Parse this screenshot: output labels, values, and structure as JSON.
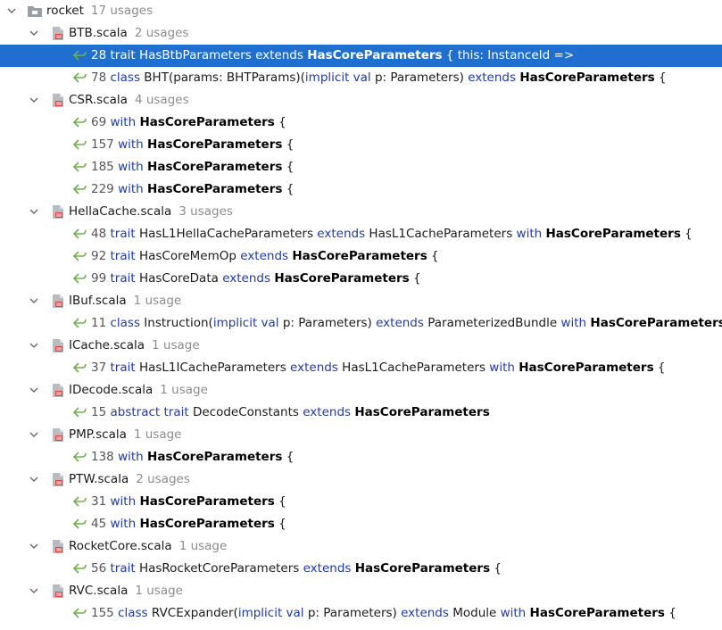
{
  "root": {
    "label": "rocket",
    "usages": "17 usages"
  },
  "files": [
    {
      "name": "BTB.scala",
      "usages": "2 usages",
      "lines": [
        {
          "num": "28",
          "selected": true,
          "parts": [
            {
              "t": "trait",
              "s": "kw"
            },
            {
              "t": " HasBtbParameters "
            },
            {
              "t": "extends",
              "s": "kw"
            },
            {
              "t": " "
            },
            {
              "t": "HasCoreParameters",
              "s": "bold"
            },
            {
              "t": " { this: InstanceId =>"
            }
          ]
        },
        {
          "num": "78",
          "parts": [
            {
              "t": "class",
              "s": "kw"
            },
            {
              "t": " BHT(params: BHTParams)("
            },
            {
              "t": "implicit val",
              "s": "kw"
            },
            {
              "t": " p: Parameters) "
            },
            {
              "t": "extends",
              "s": "kw"
            },
            {
              "t": " "
            },
            {
              "t": "HasCoreParameters",
              "s": "bold"
            },
            {
              "t": " {"
            }
          ]
        }
      ]
    },
    {
      "name": "CSR.scala",
      "usages": "4 usages",
      "lines": [
        {
          "num": "69",
          "parts": [
            {
              "t": "with",
              "s": "kw"
            },
            {
              "t": " "
            },
            {
              "t": "HasCoreParameters",
              "s": "bold"
            },
            {
              "t": " {"
            }
          ]
        },
        {
          "num": "157",
          "parts": [
            {
              "t": "with",
              "s": "kw"
            },
            {
              "t": " "
            },
            {
              "t": "HasCoreParameters",
              "s": "bold"
            },
            {
              "t": " {"
            }
          ]
        },
        {
          "num": "185",
          "parts": [
            {
              "t": "with",
              "s": "kw"
            },
            {
              "t": " "
            },
            {
              "t": "HasCoreParameters",
              "s": "bold"
            },
            {
              "t": " {"
            }
          ]
        },
        {
          "num": "229",
          "parts": [
            {
              "t": "with",
              "s": "kw"
            },
            {
              "t": " "
            },
            {
              "t": "HasCoreParameters",
              "s": "bold"
            },
            {
              "t": " {"
            }
          ]
        }
      ]
    },
    {
      "name": "HellaCache.scala",
      "usages": "3 usages",
      "lines": [
        {
          "num": "48",
          "parts": [
            {
              "t": "trait",
              "s": "kw"
            },
            {
              "t": " HasL1HellaCacheParameters "
            },
            {
              "t": "extends",
              "s": "kw"
            },
            {
              "t": " HasL1CacheParameters "
            },
            {
              "t": "with",
              "s": "kw"
            },
            {
              "t": " "
            },
            {
              "t": "HasCoreParameters",
              "s": "bold"
            },
            {
              "t": " {"
            }
          ]
        },
        {
          "num": "92",
          "parts": [
            {
              "t": "trait",
              "s": "kw"
            },
            {
              "t": " HasCoreMemOp "
            },
            {
              "t": "extends",
              "s": "kw"
            },
            {
              "t": " "
            },
            {
              "t": "HasCoreParameters",
              "s": "bold"
            },
            {
              "t": " {"
            }
          ]
        },
        {
          "num": "99",
          "parts": [
            {
              "t": "trait",
              "s": "kw"
            },
            {
              "t": " HasCoreData "
            },
            {
              "t": "extends",
              "s": "kw"
            },
            {
              "t": " "
            },
            {
              "t": "HasCoreParameters",
              "s": "bold"
            },
            {
              "t": " {"
            }
          ]
        }
      ]
    },
    {
      "name": "IBuf.scala",
      "usages": "1 usage",
      "lines": [
        {
          "num": "11",
          "parts": [
            {
              "t": "class",
              "s": "kw"
            },
            {
              "t": " Instruction("
            },
            {
              "t": "implicit val",
              "s": "kw"
            },
            {
              "t": " p: Parameters) "
            },
            {
              "t": "extends",
              "s": "kw"
            },
            {
              "t": " ParameterizedBundle "
            },
            {
              "t": "with",
              "s": "kw"
            },
            {
              "t": " "
            },
            {
              "t": "HasCoreParameters",
              "s": "bold"
            },
            {
              "t": " {"
            }
          ]
        }
      ]
    },
    {
      "name": "ICache.scala",
      "usages": "1 usage",
      "lines": [
        {
          "num": "37",
          "parts": [
            {
              "t": "trait",
              "s": "kw"
            },
            {
              "t": " HasL1ICacheParameters "
            },
            {
              "t": "extends",
              "s": "kw"
            },
            {
              "t": " HasL1CacheParameters "
            },
            {
              "t": "with",
              "s": "kw"
            },
            {
              "t": " "
            },
            {
              "t": "HasCoreParameters",
              "s": "bold"
            },
            {
              "t": " {"
            }
          ]
        }
      ]
    },
    {
      "name": "IDecode.scala",
      "usages": "1 usage",
      "lines": [
        {
          "num": "15",
          "parts": [
            {
              "t": "abstract trait",
              "s": "kw"
            },
            {
              "t": " DecodeConstants "
            },
            {
              "t": "extends",
              "s": "kw"
            },
            {
              "t": " "
            },
            {
              "t": "HasCoreParameters",
              "s": "bold"
            }
          ]
        }
      ]
    },
    {
      "name": "PMP.scala",
      "usages": "1 usage",
      "lines": [
        {
          "num": "138",
          "parts": [
            {
              "t": "with",
              "s": "kw"
            },
            {
              "t": " "
            },
            {
              "t": "HasCoreParameters",
              "s": "bold"
            },
            {
              "t": " {"
            }
          ]
        }
      ]
    },
    {
      "name": "PTW.scala",
      "usages": "2 usages",
      "lines": [
        {
          "num": "31",
          "parts": [
            {
              "t": "with",
              "s": "kw"
            },
            {
              "t": " "
            },
            {
              "t": "HasCoreParameters",
              "s": "bold"
            },
            {
              "t": " {"
            }
          ]
        },
        {
          "num": "45",
          "parts": [
            {
              "t": "with",
              "s": "kw"
            },
            {
              "t": " "
            },
            {
              "t": "HasCoreParameters",
              "s": "bold"
            },
            {
              "t": " {"
            }
          ]
        }
      ]
    },
    {
      "name": "RocketCore.scala",
      "usages": "1 usage",
      "lines": [
        {
          "num": "56",
          "parts": [
            {
              "t": "trait",
              "s": "kw"
            },
            {
              "t": " HasRocketCoreParameters "
            },
            {
              "t": "extends",
              "s": "kw"
            },
            {
              "t": " "
            },
            {
              "t": "HasCoreParameters",
              "s": "bold"
            },
            {
              "t": " {"
            }
          ]
        }
      ]
    },
    {
      "name": "RVC.scala",
      "usages": "1 usage",
      "lines": [
        {
          "num": "155",
          "parts": [
            {
              "t": "class",
              "s": "kw"
            },
            {
              "t": " RVCExpander("
            },
            {
              "t": "implicit val",
              "s": "kw"
            },
            {
              "t": " p: Parameters) "
            },
            {
              "t": "extends",
              "s": "kw"
            },
            {
              "t": " Module "
            },
            {
              "t": "with",
              "s": "kw"
            },
            {
              "t": " "
            },
            {
              "t": "HasCoreParameters",
              "s": "bold"
            },
            {
              "t": " {"
            }
          ]
        }
      ]
    }
  ],
  "colors": {
    "selection": "#1f6fd0",
    "keyword": "#1f3aa8",
    "usage_count": "#8c8c8c",
    "usage_arrow": "#6bb349",
    "file_icon_badge": "#e0443e"
  },
  "icons": {
    "expand": "chevron-down-icon",
    "package": "package-folder-icon",
    "file": "scala-file-icon",
    "usage": "usage-arrow-icon"
  }
}
